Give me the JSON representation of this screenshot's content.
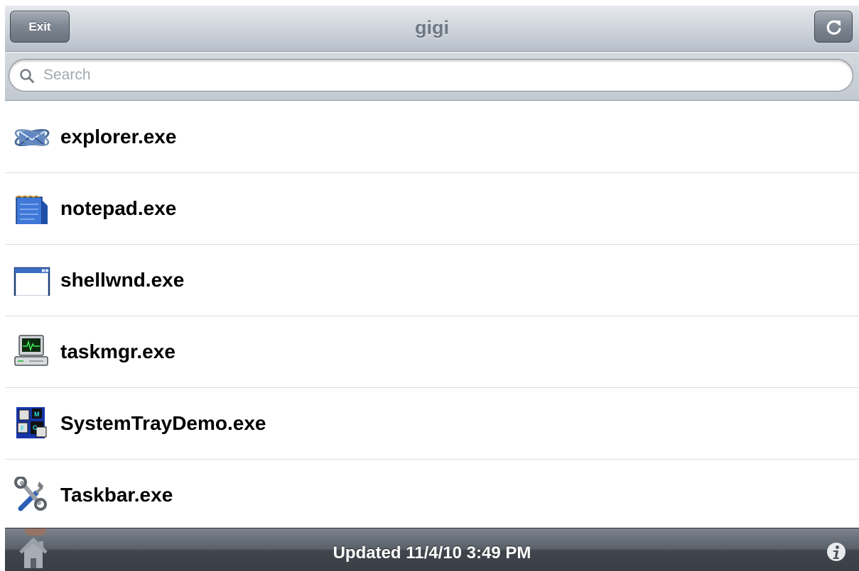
{
  "navbar": {
    "title": "gigi",
    "exit_label": "Exit",
    "refresh_icon": "refresh-icon"
  },
  "search": {
    "placeholder": "Search",
    "value": ""
  },
  "processes": [
    {
      "name": "explorer.exe",
      "icon": "explorer-icon"
    },
    {
      "name": "notepad.exe",
      "icon": "notepad-icon"
    },
    {
      "name": "shellwnd.exe",
      "icon": "window-icon"
    },
    {
      "name": "taskmgr.exe",
      "icon": "task-manager-icon"
    },
    {
      "name": "SystemTrayDemo.exe",
      "icon": "mfc-app-icon"
    },
    {
      "name": "Taskbar.exe",
      "icon": "tools-icon"
    }
  ],
  "toolbar": {
    "status": "Updated 11/4/10 3:49 PM",
    "home_icon": "home-icon",
    "info_icon": "info-icon"
  },
  "colors": {
    "navbar": "#cdd3da",
    "toolbar": "#4a5058",
    "title_text": "#6f7884"
  }
}
